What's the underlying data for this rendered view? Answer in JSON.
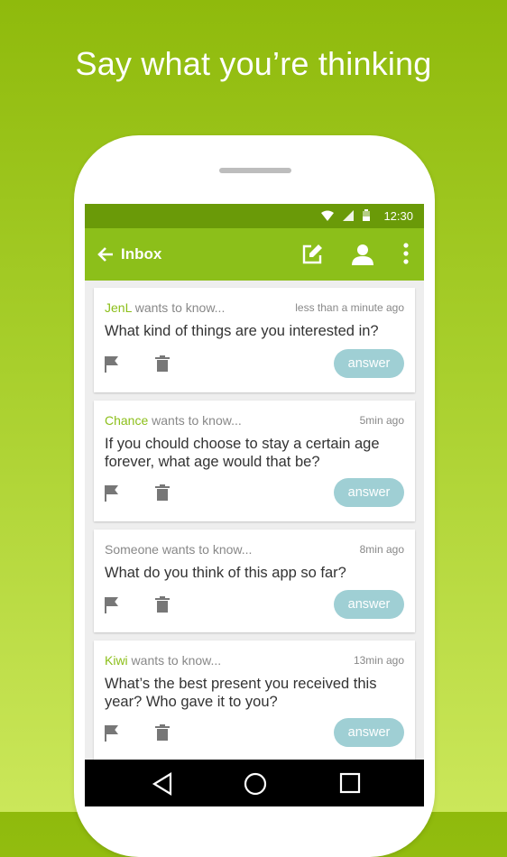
{
  "headline": "Say what you’re thinking",
  "statusbar": {
    "time": "12:30"
  },
  "appbar": {
    "title": "Inbox"
  },
  "cards": [
    {
      "name": "JenL",
      "suffix": " wants to know...",
      "time": "less than a minute ago",
      "question": "What kind of things are you interested in?",
      "answer": "answer"
    },
    {
      "name": "Chance",
      "suffix": " wants to know...",
      "time": "5min ago",
      "question": "If you chould choose to stay a certain age forever, what age would that be?",
      "answer": "answer"
    },
    {
      "name": "",
      "suffix": "Someone wants to know...",
      "time": "8min ago",
      "question": "What do you think of this app so far?",
      "answer": "answer"
    },
    {
      "name": "Kiwi",
      "suffix": " wants to know...",
      "time": "13min ago",
      "question": "What’s the best present you received this year? Who gave it to you?",
      "answer": "answer"
    }
  ],
  "colors": {
    "accent": "#8cbf1a",
    "answer_button": "#9fcfd4"
  }
}
